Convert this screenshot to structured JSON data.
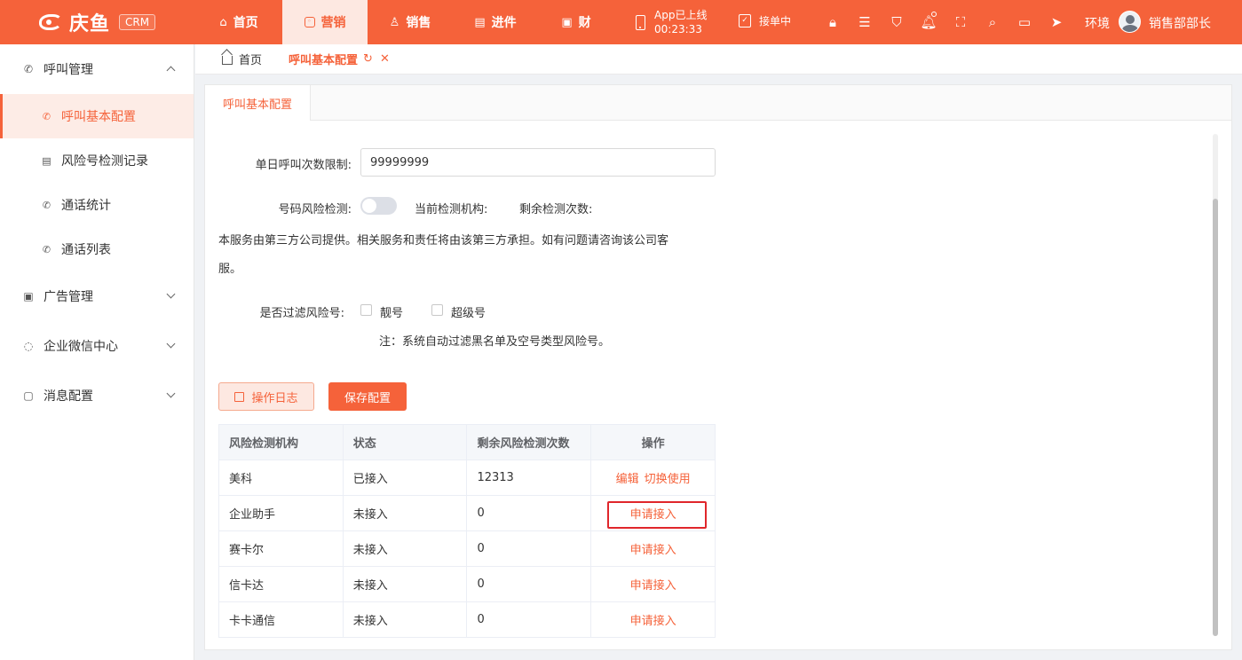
{
  "brand": {
    "name": "庆鱼",
    "badge": "CRM"
  },
  "nav": [
    {
      "label": "首页",
      "icon": "home-icon",
      "glyph": "⌂",
      "width": 98,
      "active": false
    },
    {
      "label": "营销",
      "icon": "marketing-icon",
      "glyph": "◎",
      "width": 96,
      "active": true
    },
    {
      "label": "销售",
      "icon": "sales-icon",
      "glyph": "♙",
      "width": 96,
      "active": false
    },
    {
      "label": "进件",
      "icon": "application-icon",
      "glyph": "▤",
      "width": 96,
      "active": false
    },
    {
      "label": "财",
      "icon": "finance-icon",
      "glyph": "▣",
      "width": 86,
      "active": false
    }
  ],
  "app_status": {
    "line1": "App已上线",
    "line2": "00:23:33"
  },
  "receive_label": "接单中",
  "tools": [
    {
      "icon": "lock-icon",
      "glyph": "🔒︎"
    },
    {
      "icon": "search-list-icon",
      "glyph": "☰"
    },
    {
      "icon": "shirt-icon",
      "glyph": "⛉"
    },
    {
      "icon": "bell-icon",
      "glyph": "🔔︎"
    },
    {
      "icon": "fullscreen-icon",
      "glyph": "⛶"
    },
    {
      "icon": "search-icon",
      "glyph": "⌕"
    },
    {
      "icon": "briefcase-icon",
      "glyph": "▭"
    },
    {
      "icon": "send-icon",
      "glyph": "➤"
    }
  ],
  "env_label": "环境",
  "username": "销售部部长",
  "sidebar": {
    "groups": [
      {
        "label": "呼叫管理",
        "icon": "phone-icon",
        "glyph": "✆",
        "expanded": true,
        "items": [
          {
            "label": "呼叫基本配置",
            "icon": "phone-config-icon",
            "glyph": "✆",
            "active": true
          },
          {
            "label": "风险号检测记录",
            "icon": "record-icon",
            "glyph": "▤",
            "active": false
          },
          {
            "label": "通话统计",
            "icon": "call-stats-icon",
            "glyph": "✆",
            "active": false
          },
          {
            "label": "通话列表",
            "icon": "call-list-icon",
            "glyph": "✆",
            "active": false
          }
        ]
      },
      {
        "label": "广告管理",
        "icon": "ad-icon",
        "glyph": "▣",
        "expanded": false,
        "items": []
      },
      {
        "label": "企业微信中心",
        "icon": "wechat-icon",
        "glyph": "◌",
        "expanded": false,
        "items": []
      },
      {
        "label": "消息配置",
        "icon": "message-icon",
        "glyph": "▢",
        "expanded": false,
        "items": []
      }
    ]
  },
  "breadcrumb": {
    "home": "首页",
    "current": "呼叫基本配置"
  },
  "panel_tab": "呼叫基本配置",
  "form": {
    "daily_limit_label": "单日呼叫次数限制:",
    "daily_limit_value": "99999999",
    "risk_check_label": "号码风险检测:",
    "risk_check_enabled": false,
    "current_agency_label": "当前检测机构:",
    "remaining_label": "剩余检测次数:",
    "disclaimer_line1": "本服务由第三方公司提供。相关服务和责任将由该第三方承担。如有问题请咨询该公司客",
    "disclaimer_line2": "服。",
    "filter_label": "是否过滤风险号:",
    "option_pretty": "靓号",
    "option_super": "超级号",
    "note": "注：系统自动过滤黑名单及空号类型风险号。"
  },
  "buttons": {
    "log": "操作日志",
    "save": "保存配置"
  },
  "table": {
    "headers": [
      "风险检测机构",
      "状态",
      "剩余风险检测次数",
      "操作"
    ],
    "rows": [
      {
        "agency": "美科",
        "status": "已接入",
        "remaining": "12313",
        "actions": [
          "编辑",
          "切换使用"
        ]
      },
      {
        "agency": "企业助手",
        "status": "未接入",
        "remaining": "0",
        "actions": [
          "申请接入"
        ]
      },
      {
        "agency": "赛卡尔",
        "status": "未接入",
        "remaining": "0",
        "actions": [
          "申请接入"
        ]
      },
      {
        "agency": "信卡达",
        "status": "未接入",
        "remaining": "0",
        "actions": [
          "申请接入"
        ]
      },
      {
        "agency": "卡卡通信",
        "status": "未接入",
        "remaining": "0",
        "actions": [
          "申请接入"
        ]
      }
    ]
  },
  "colors": {
    "accent": "#f5623a",
    "highlight": "#e0262b"
  }
}
